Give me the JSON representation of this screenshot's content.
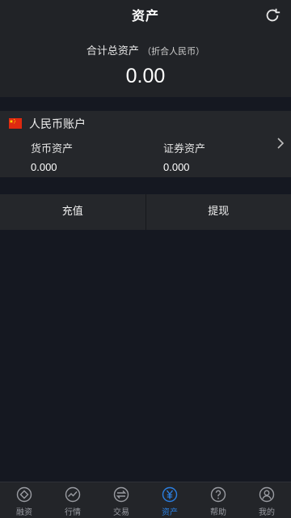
{
  "header": {
    "title": "资产",
    "total_label": "合计总资产",
    "total_sub": "（折合人民币）",
    "total_value": "0.00"
  },
  "account": {
    "name": "人民币账户",
    "currency_label": "货币资产",
    "currency_value": "0.000",
    "securities_label": "证券资产",
    "securities_value": "0.000"
  },
  "actions": {
    "deposit": "充值",
    "withdraw": "提现"
  },
  "tabs": [
    {
      "label": "融资",
      "icon": "financing-icon"
    },
    {
      "label": "行情",
      "icon": "market-icon"
    },
    {
      "label": "交易",
      "icon": "trade-icon"
    },
    {
      "label": "资产",
      "icon": "yuan-icon"
    },
    {
      "label": "帮助",
      "icon": "help-icon"
    },
    {
      "label": "我的",
      "icon": "profile-icon"
    }
  ],
  "colors": {
    "background": "#151821",
    "panel": "#25272b",
    "active_tab": "#2b7fe1",
    "inactive_tab": "#9a9ca2"
  }
}
